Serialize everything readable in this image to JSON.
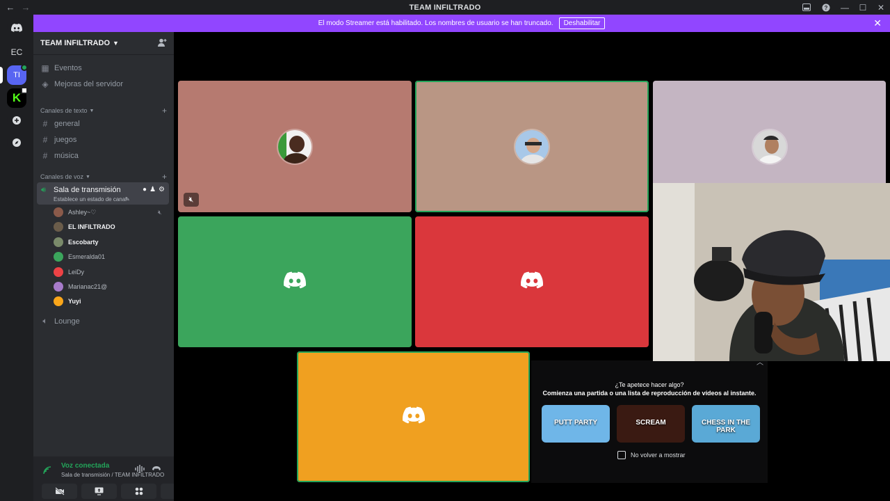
{
  "window": {
    "title": "TEAM INFILTRADO",
    "back_glyph": "←",
    "forward_glyph": "→"
  },
  "guilds": {
    "ec_label": "EC",
    "ti_label": "TI",
    "k_label": "K"
  },
  "banner": {
    "text": "El modo Streamer está habilitado. Los nombres de usuario se han truncado.",
    "button": "Deshabilitar"
  },
  "server": {
    "name": "TEAM INFILTRADO",
    "items": [
      {
        "label": "Eventos",
        "icon": "calendar-icon"
      },
      {
        "label": "Mejoras del servidor",
        "icon": "boost-icon"
      }
    ],
    "text_category": "Canales de texto",
    "text_channels": [
      "general",
      "juegos",
      "música"
    ],
    "voice_category": "Canales de voz",
    "active_voice": {
      "name": "Sala de transmisión",
      "status": "Establece un estado de canal"
    },
    "voice_users": [
      {
        "name": "Ashley~♡",
        "color": "#8a5a4a",
        "bold": false,
        "muted": true
      },
      {
        "name": "EL INFILTRADO",
        "color": "#6a5c4a",
        "bold": true,
        "muted": false
      },
      {
        "name": "Escobarty",
        "color": "#7a8a6a",
        "bold": true,
        "muted": false
      },
      {
        "name": "Esmeralda01",
        "color": "#3ba55c",
        "bold": false,
        "muted": false
      },
      {
        "name": "LeiDy",
        "color": "#ed4245",
        "bold": false,
        "muted": false
      },
      {
        "name": "Marianac21@",
        "color": "#a77bca",
        "bold": false,
        "muted": false
      },
      {
        "name": "Yuyi",
        "color": "#faa61a",
        "bold": true,
        "muted": false
      }
    ],
    "lounge": "Lounge"
  },
  "voice_panel": {
    "status": "Voz conectada",
    "channel": "Sala de transmisión / TEAM INFILTRADO"
  },
  "tiles": [
    {
      "bg": "#b67a70",
      "kind": "avatar"
    },
    {
      "bg": "#b99684",
      "kind": "avatar"
    },
    {
      "bg": "#c4b5c2",
      "kind": "avatar"
    },
    {
      "bg": "#3ba55c",
      "kind": "discord"
    },
    {
      "bg": "#da373c",
      "kind": "discord"
    },
    {
      "bg": "#f0a020",
      "kind": "discord"
    }
  ],
  "promo": {
    "title": "¿Te apetece hacer algo?",
    "subtitle": "Comienza una partida o una lista de reproducción de vídeos al instante.",
    "games": [
      {
        "label": "PUTT PARTY",
        "bg": "#6fb6e8"
      },
      {
        "label": "SCREAM",
        "bg": "#3a1a12"
      },
      {
        "label": "CHESS IN THE PARK",
        "bg": "#5aa9d6"
      }
    ],
    "checkbox": "No volver a mostrar"
  }
}
